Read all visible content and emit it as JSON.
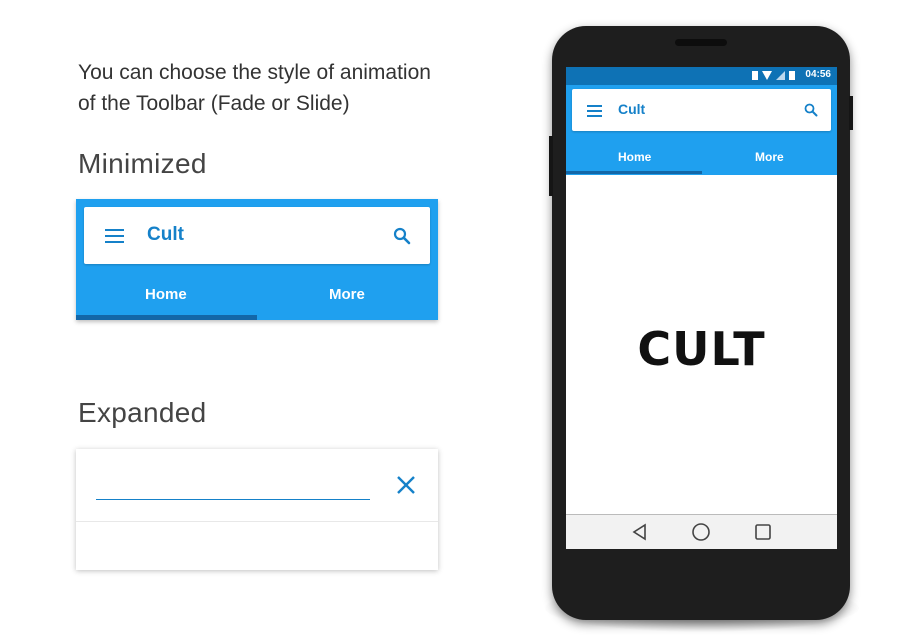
{
  "intro": {
    "line1": "You can choose the style of animation",
    "line2": "of the Toolbar (Fade or Slide)"
  },
  "minimized": {
    "heading": "Minimized",
    "title": "Cult",
    "tabs": [
      "Home",
      "More"
    ]
  },
  "expanded": {
    "heading": "Expanded"
  },
  "phone": {
    "status_time": "04:56",
    "title": "Cult",
    "tabs": [
      "Home",
      "More"
    ],
    "logo_text": "CULT"
  },
  "colors": {
    "accent": "#1fa0ef",
    "primary_dark": "#1581c9",
    "status_bar": "#0e72b5",
    "tab_indicator": "#1367a8"
  }
}
